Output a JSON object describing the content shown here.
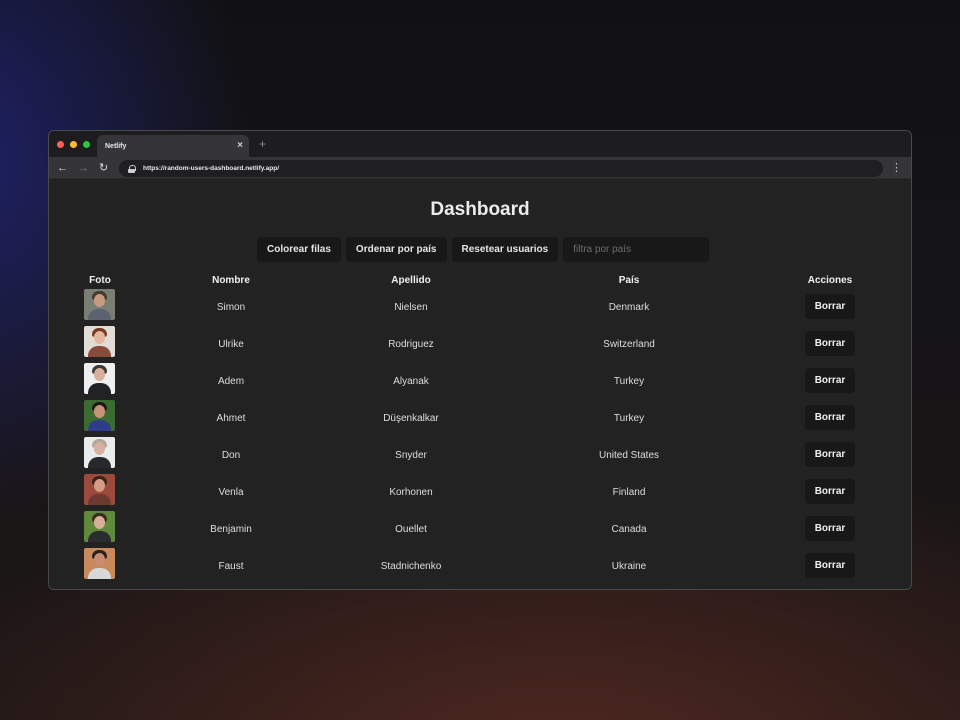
{
  "browser": {
    "tab_title": "Netlify",
    "tab_close": "×",
    "new_tab": "+",
    "url": "https://random-users-dashboard.netlify.app/",
    "icons": {
      "back": "←",
      "forward": "→",
      "reload": "↻",
      "menu": "⋮"
    }
  },
  "page": {
    "title": "Dashboard",
    "controls": {
      "color_rows": "Colorear filas",
      "sort_country": "Ordenar por país",
      "reset_users": "Resetear usuarios",
      "filter_placeholder": "filtra por país"
    },
    "table": {
      "headers": {
        "photo": "Foto",
        "first_name": "Nombre",
        "last_name": "Apellido",
        "country": "País",
        "actions": "Acciones"
      },
      "delete_label": "Borrar",
      "rows": [
        {
          "first": "Simon",
          "last": "Nielsen",
          "country": "Denmark",
          "avatar": {
            "bg": "#7a7f76",
            "hair": "#4a3a2c",
            "skin": "#c89c80",
            "shirt": "#5b6370"
          }
        },
        {
          "first": "Ulrike",
          "last": "Rodriguez",
          "country": "Switzerland",
          "avatar": {
            "bg": "#e2dcd6",
            "hair": "#7a3b24",
            "skin": "#e6b8a0",
            "shirt": "#8a4a3a"
          }
        },
        {
          "first": "Adem",
          "last": "Alyanak",
          "country": "Turkey",
          "avatar": {
            "bg": "#eef0f0",
            "hair": "#3d3a38",
            "skin": "#d8b09a",
            "shirt": "#202226"
          }
        },
        {
          "first": "Ahmet",
          "last": "Düşenkalkar",
          "country": "Turkey",
          "avatar": {
            "bg": "#3c6b32",
            "hair": "#1e1a18",
            "skin": "#c89478",
            "shirt": "#2e3c8a"
          }
        },
        {
          "first": "Don",
          "last": "Snyder",
          "country": "United States",
          "avatar": {
            "bg": "#e8ecec",
            "hair": "#b8a898",
            "skin": "#d6b0a0",
            "shirt": "#26282c"
          }
        },
        {
          "first": "Venla",
          "last": "Korhonen",
          "country": "Finland",
          "avatar": {
            "bg": "#9c4a3c",
            "hair": "#3a2418",
            "skin": "#d49c84",
            "shirt": "#6c3a30"
          }
        },
        {
          "first": "Benjamin",
          "last": "Ouellet",
          "country": "Canada",
          "avatar": {
            "bg": "#5f8a3c",
            "hair": "#3a2a20",
            "skin": "#d8b09a",
            "shirt": "#2a2c30"
          }
        },
        {
          "first": "Faust",
          "last": "Stadnichenko",
          "country": "Ukraine",
          "avatar": {
            "bg": "#c88a5c",
            "hair": "#2a2220",
            "skin": "#c88c70",
            "shirt": "#d8d8d8"
          }
        }
      ]
    }
  }
}
